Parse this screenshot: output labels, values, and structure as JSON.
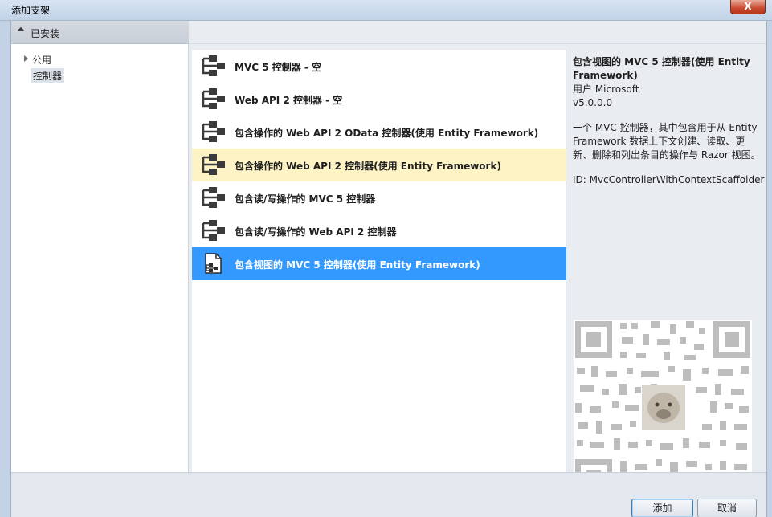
{
  "window": {
    "title": "添加支架",
    "close_label": "X"
  },
  "left": {
    "header": "已安装",
    "items": [
      {
        "label": "公用"
      },
      {
        "label": "控制器"
      }
    ]
  },
  "list": {
    "items": [
      {
        "label": "MVC 5 控制器 - 空",
        "icon": "controller-icon",
        "state": "normal"
      },
      {
        "label": "Web API 2 控制器 - 空",
        "icon": "controller-icon",
        "state": "normal"
      },
      {
        "label": "包含操作的 Web API 2 OData 控制器(使用 Entity Framework)",
        "icon": "controller-icon",
        "state": "normal"
      },
      {
        "label": "包含操作的 Web API 2 控制器(使用 Entity Framework)",
        "icon": "controller-icon",
        "state": "hover"
      },
      {
        "label": "包含读/写操作的 MVC 5 控制器",
        "icon": "controller-icon",
        "state": "normal"
      },
      {
        "label": "包含读/写操作的 Web API 2 控制器",
        "icon": "controller-icon",
        "state": "normal"
      },
      {
        "label": "包含视图的 MVC 5 控制器(使用 Entity Framework)",
        "icon": "controller-with-views-icon",
        "state": "selected"
      }
    ]
  },
  "details": {
    "title": "包含视图的 MVC 5 控制器(使用 Entity Framework)",
    "author": "用户 Microsoft",
    "version": "v5.0.0.0",
    "description": "一个 MVC 控制器，其中包含用于从 Entity Framework 数据上下文创建、读取、更新、删除和列出条目的操作与 Razor 视图。",
    "id": "ID: MvcControllerWithContextScaffolder"
  },
  "buttons": {
    "add": "添加",
    "cancel": "取消"
  },
  "colors": {
    "selected": "#3399ff",
    "hover": "#fdf3c4"
  }
}
